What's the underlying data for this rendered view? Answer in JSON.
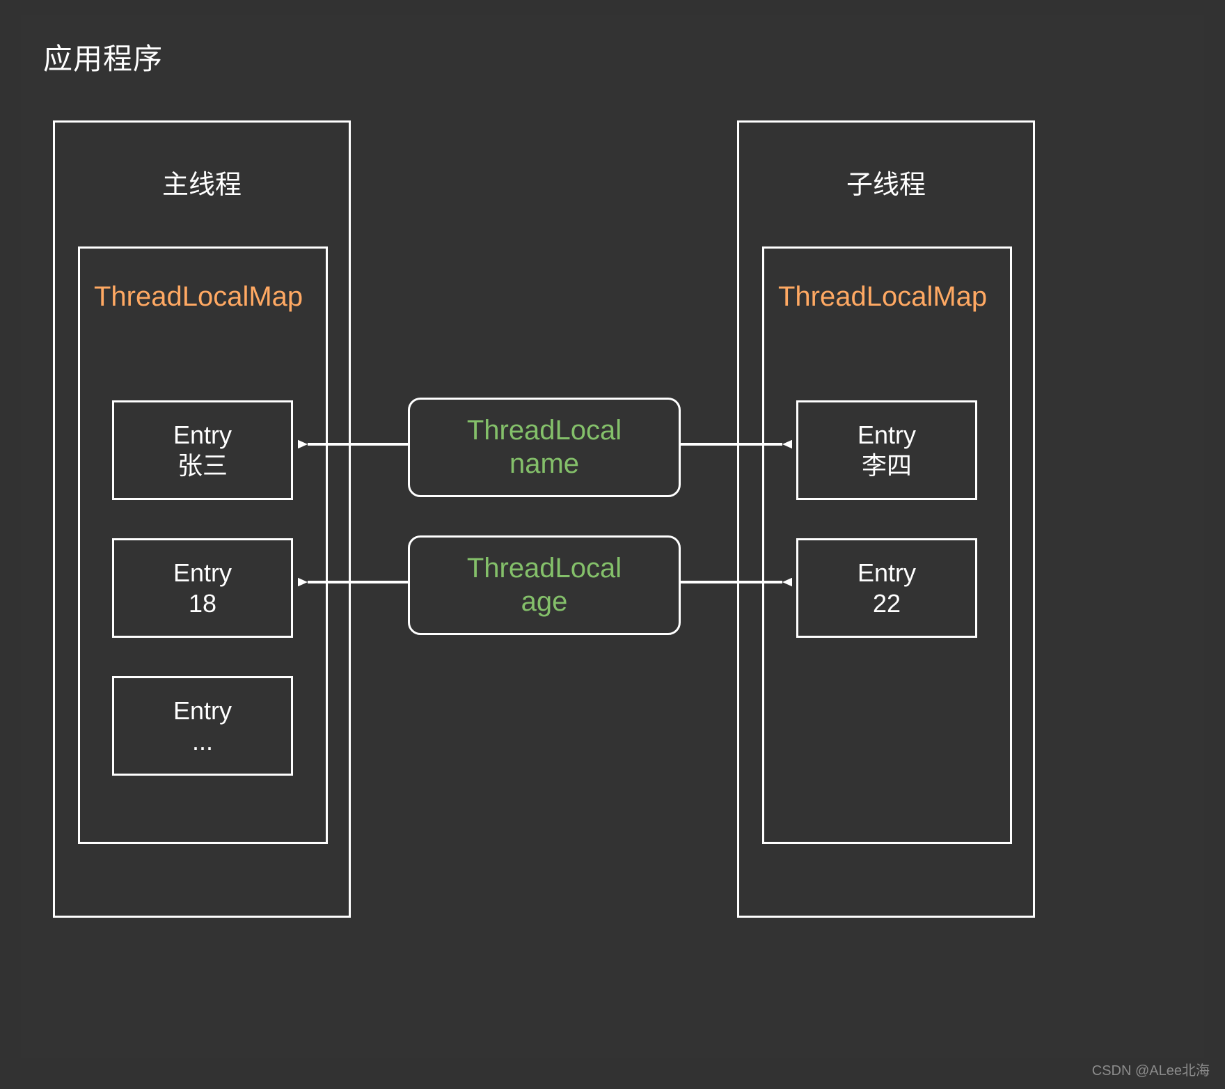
{
  "diagram": {
    "title": "应用程序",
    "background_color": "#323232",
    "stroke_color": "#ffffff",
    "accent_orange": "#ffa963",
    "accent_green": "#84c06a"
  },
  "threads": [
    {
      "name": "主线程",
      "map_label": "ThreadLocalMap",
      "entries": [
        {
          "line1": "Entry",
          "line2": "张三"
        },
        {
          "line1": "Entry",
          "line2": "18"
        },
        {
          "line1": "Entry",
          "line2": "..."
        }
      ]
    },
    {
      "name": "子线程",
      "map_label": "ThreadLocalMap",
      "entries": [
        {
          "line1": "Entry",
          "line2": "李四"
        },
        {
          "line1": "Entry",
          "line2": "22"
        }
      ]
    }
  ],
  "threadlocals": [
    {
      "line1": "ThreadLocal",
      "line2": "name"
    },
    {
      "line1": "ThreadLocal",
      "line2": "age"
    }
  ],
  "watermark": "CSDN @ALee北海"
}
